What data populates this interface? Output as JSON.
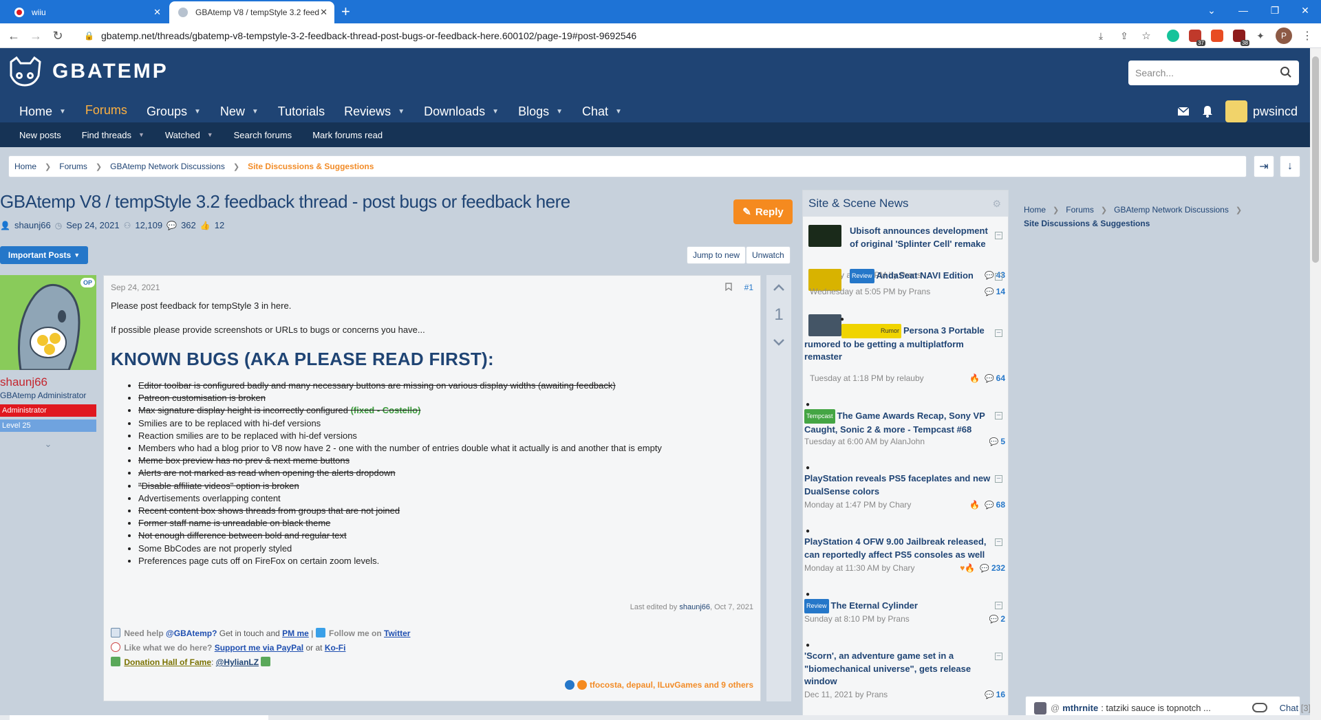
{
  "browser": {
    "tabs": [
      {
        "title": "wiiu",
        "active": false
      },
      {
        "title": "GBAtemp V8 / tempStyle 3.2 feedback",
        "active": true
      }
    ],
    "url": "gbatemp.net/threads/gbatemp-v8-tempstyle-3-2-feedback-thread-post-bugs-or-feedback-here.600102/page-19#post-9692546",
    "ext_badges": {
      "a": "37",
      "b": "38"
    },
    "profile_initial": "P"
  },
  "site": {
    "logo_text": "GBATEMP",
    "search_placeholder": "Search...",
    "nav": [
      {
        "label": "Home",
        "caret": true,
        "active": false
      },
      {
        "label": "Forums",
        "caret": false,
        "active": true
      },
      {
        "label": "Groups",
        "caret": true,
        "active": false
      },
      {
        "label": "New",
        "caret": true,
        "active": false
      },
      {
        "label": "Tutorials",
        "caret": false,
        "active": false
      },
      {
        "label": "Reviews",
        "caret": true,
        "active": false
      },
      {
        "label": "Downloads",
        "caret": true,
        "active": false
      },
      {
        "label": "Blogs",
        "caret": true,
        "active": false
      },
      {
        "label": "Chat",
        "caret": true,
        "active": false
      }
    ],
    "username": "pwsincd",
    "subnav": [
      {
        "label": "New posts",
        "caret": false
      },
      {
        "label": "Find threads",
        "caret": true
      },
      {
        "label": "Watched",
        "caret": true
      },
      {
        "label": "Search forums",
        "caret": false
      },
      {
        "label": "Mark forums read",
        "caret": false
      }
    ]
  },
  "breadcrumbs": [
    "Home",
    "Forums",
    "GBAtemp Network Discussions",
    "Site Discussions & Suggestions"
  ],
  "thread": {
    "title": "GBAtemp V8 / tempStyle 3.2 feedback thread - post bugs or feedback here",
    "author": "shaunj66",
    "date": "Sep 24, 2021",
    "views": "12,109",
    "replies": "362",
    "likes": "12",
    "reply_label": "Reply",
    "important_label": "Important Posts",
    "jump_label": "Jump to new",
    "unwatch_label": "Unwatch"
  },
  "post": {
    "user": {
      "name": "shaunj66",
      "title": "GBAtemp Administrator",
      "banner1": "Administrator",
      "banner2": "Level 25",
      "op": "OP"
    },
    "date": "Sep 24, 2021",
    "number": "#1",
    "p1": "Please post feedback for tempStyle 3 in here.",
    "p2": "If possible please provide screenshots or URLs to bugs or concerns you have...",
    "heading": "KNOWN BUGS (AKA PLEASE READ FIRST):",
    "bugs": [
      {
        "text": "Editor toolbar is configured badly and many necessary buttons are missing on various display widths (awaiting feedback)",
        "struck": true
      },
      {
        "text": "Patreon customisation is broken",
        "struck": true
      },
      {
        "text": "Max signature display height is incorrectly configured",
        "struck": true,
        "fixed": "(fixed - Costello)"
      },
      {
        "text": "Smilies are to be replaced with hi-def versions",
        "struck": false
      },
      {
        "text": "Reaction smilies are to be replaced with hi-def versions",
        "struck": false
      },
      {
        "text": "Members who had a blog prior to V8 now have 2 - one with the number of entries double what it actually is and another that is empty",
        "struck": false
      },
      {
        "text": "Meme box preview has no prev & next meme buttons",
        "struck": true
      },
      {
        "text": "Alerts are not marked as read when opening the alerts dropdown",
        "struck": true
      },
      {
        "text": "\"Disable affiliate videos\" option is broken",
        "struck": true
      },
      {
        "text": "Advertisements overlapping content",
        "struck": false
      },
      {
        "text": "Recent content box shows threads from groups that are not joined",
        "struck": true
      },
      {
        "text": "Former staff name is unreadable on black theme",
        "struck": true
      },
      {
        "text": "Not enough difference between bold and regular text",
        "struck": true
      },
      {
        "text": "Some BbCodes are not properly styled",
        "struck": false
      },
      {
        "text": "Preferences page cuts off on FireFox on certain zoom levels.",
        "struck": false
      }
    ],
    "edited_prefix": "Last edited by",
    "edited_by": "shaunj66",
    "edited_date": ", Oct 7, 2021",
    "vote_count": "1",
    "signature": {
      "need_help": "Need help",
      "gbatemp": "@GBAtemp?",
      "get_in_touch": "Get in touch and",
      "pm_me": "PM me",
      "pipe": "|",
      "follow": "Follow me on",
      "twitter": "Twitter",
      "like": "Like what we do here?",
      "paypal": "Support me via PayPal",
      "or_at": "or at",
      "kofi": "Ko-Fi",
      "hof": "Donation Hall of Fame",
      "colon": ":",
      "hylian": "@HylianLZ"
    },
    "reactions": "tfocosta, depaul, ILuvGames and 9 others"
  },
  "news": {
    "title": "Site & Scene News",
    "items": [
      {
        "tag": "",
        "title": "Ubisoft announces development of original 'Splinter Cell' remake",
        "meta": "Thursday at 3:58 PM by Prans",
        "count": "43"
      },
      {
        "tag": "Review",
        "title": "AndaSeat NAVI Edition",
        "meta": "Wednesday at 5:05 PM by Prans",
        "count": "14"
      },
      {
        "tag": "Rumor",
        "title": "Persona 3 Portable rumored to be getting a multiplatform remaster",
        "meta": "Tuesday at 1:18 PM by relauby",
        "count": "64"
      },
      {
        "tag": "Tempcast",
        "title": "The Game Awards Recap, Sony VP Caught, Sonic 2 & more - Tempcast #68",
        "meta": "Tuesday at 6:00 AM by AlanJohn",
        "count": "5"
      },
      {
        "tag": "",
        "title": "PlayStation reveals PS5 faceplates and new DualSense colors",
        "meta": "Monday at 1:47 PM by Chary",
        "count": "68"
      },
      {
        "tag": "",
        "title": "PlayStation 4 OFW 9.00 Jailbreak released, can reportedly affect PS5 consoles as well",
        "meta": "Monday at 11:30 AM by Chary",
        "count": "232"
      },
      {
        "tag": "Review",
        "title": "The Eternal Cylinder",
        "meta": "Sunday at 8:10 PM by Prans",
        "count": "2"
      },
      {
        "tag": "",
        "title": "'Scorn', an adventure game set in a \"biomechanical universe\", gets release window",
        "meta": "Dec 11, 2021 by Prans",
        "count": "16"
      }
    ]
  },
  "right_crumbs": [
    "Home",
    "Forums",
    "GBAtemp Network Discussions",
    "Site Discussions & Suggestions"
  ],
  "chat": {
    "user": "mthrnite",
    "message": ": tatziki sauce is topnotch ...",
    "label": "Chat",
    "count": "[3]"
  },
  "colors": {
    "header": "#1f4474",
    "accent": "#f58a1f",
    "link": "#2577c9",
    "admin_red": "#e0181f",
    "level_blue": "#6fa3df"
  }
}
